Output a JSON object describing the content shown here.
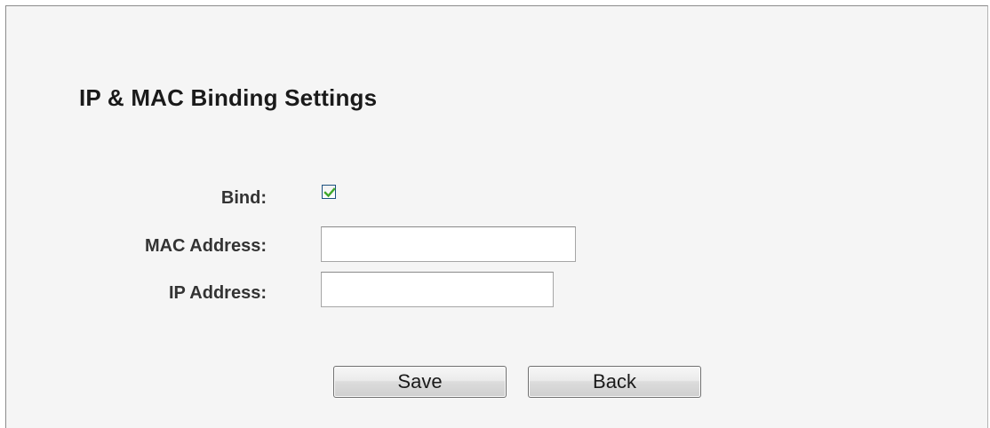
{
  "title": "IP & MAC Binding Settings",
  "form": {
    "bind_label": "Bind:",
    "bind_checked": true,
    "mac_label": "MAC Address:",
    "mac_value": "",
    "ip_label": "IP Address:",
    "ip_value": ""
  },
  "buttons": {
    "save_label": "Save",
    "back_label": "Back"
  },
  "colors": {
    "panel_background": "#f5f5f5",
    "check_mark": "#3fa82a"
  },
  "icons": {
    "checkbox": "check-icon"
  }
}
